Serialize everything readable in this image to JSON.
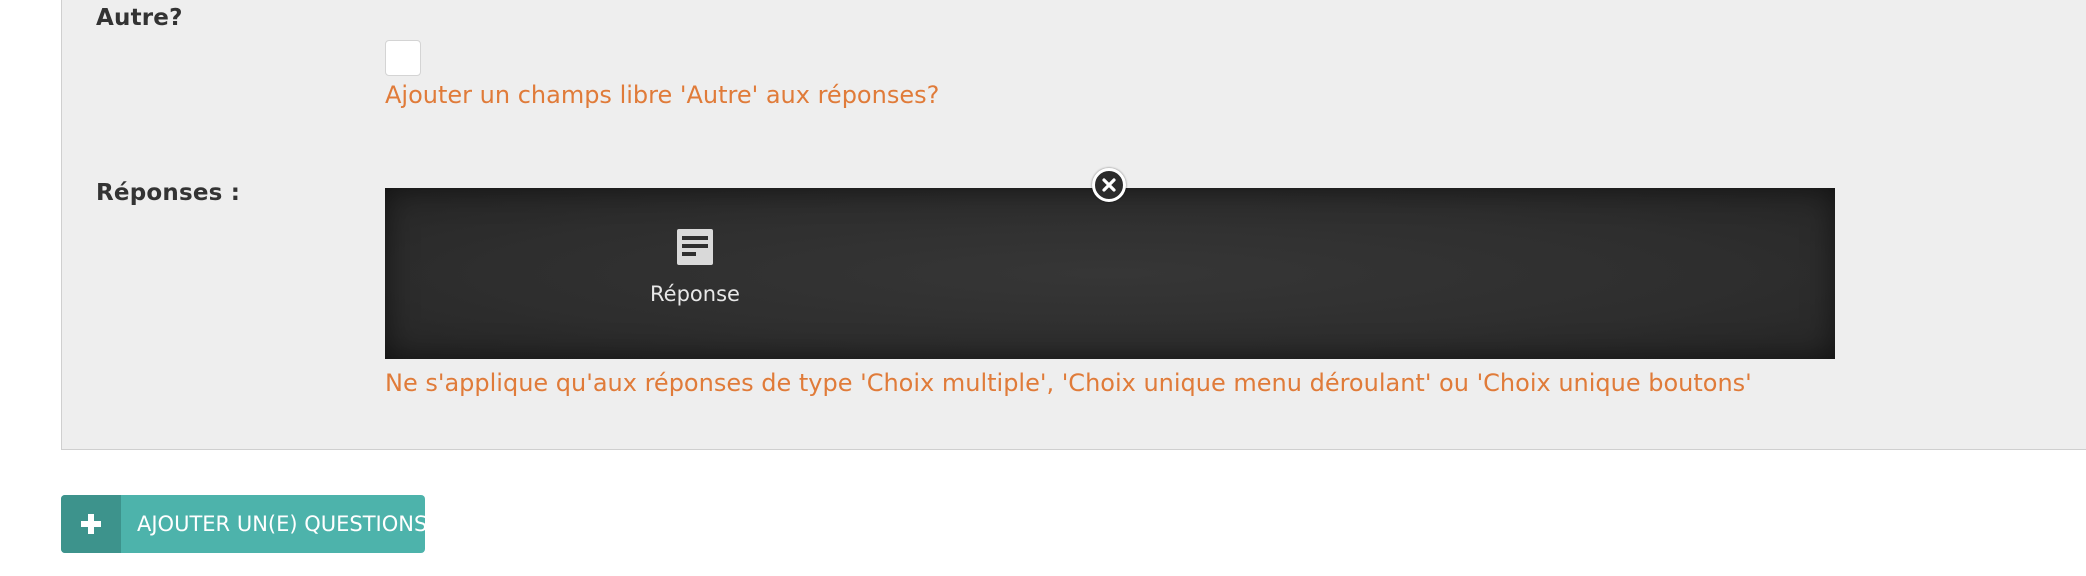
{
  "form": {
    "other": {
      "label": "Autre?",
      "help": "Ajouter un champs libre 'Autre' aux réponses?",
      "checked": false
    },
    "responses": {
      "label": "Réponses :",
      "item": {
        "icon": "form-icon",
        "label": "Réponse"
      },
      "remove_icon": "close-icon",
      "help": "Ne s'applique qu'aux réponses de type 'Choix multiple', 'Choix unique menu déroulant' ou 'Choix unique boutons'"
    }
  },
  "actions": {
    "add_question": {
      "icon": "plus-icon",
      "label": "AJOUTER UN(E) QUESTIONS"
    }
  },
  "colors": {
    "help_text": "#e07b39",
    "panel_bg": "#eeeeee",
    "collection_bg": "#2e2e2e",
    "button_bg": "#4db3ab",
    "button_icon_bg": "#3d938c"
  }
}
